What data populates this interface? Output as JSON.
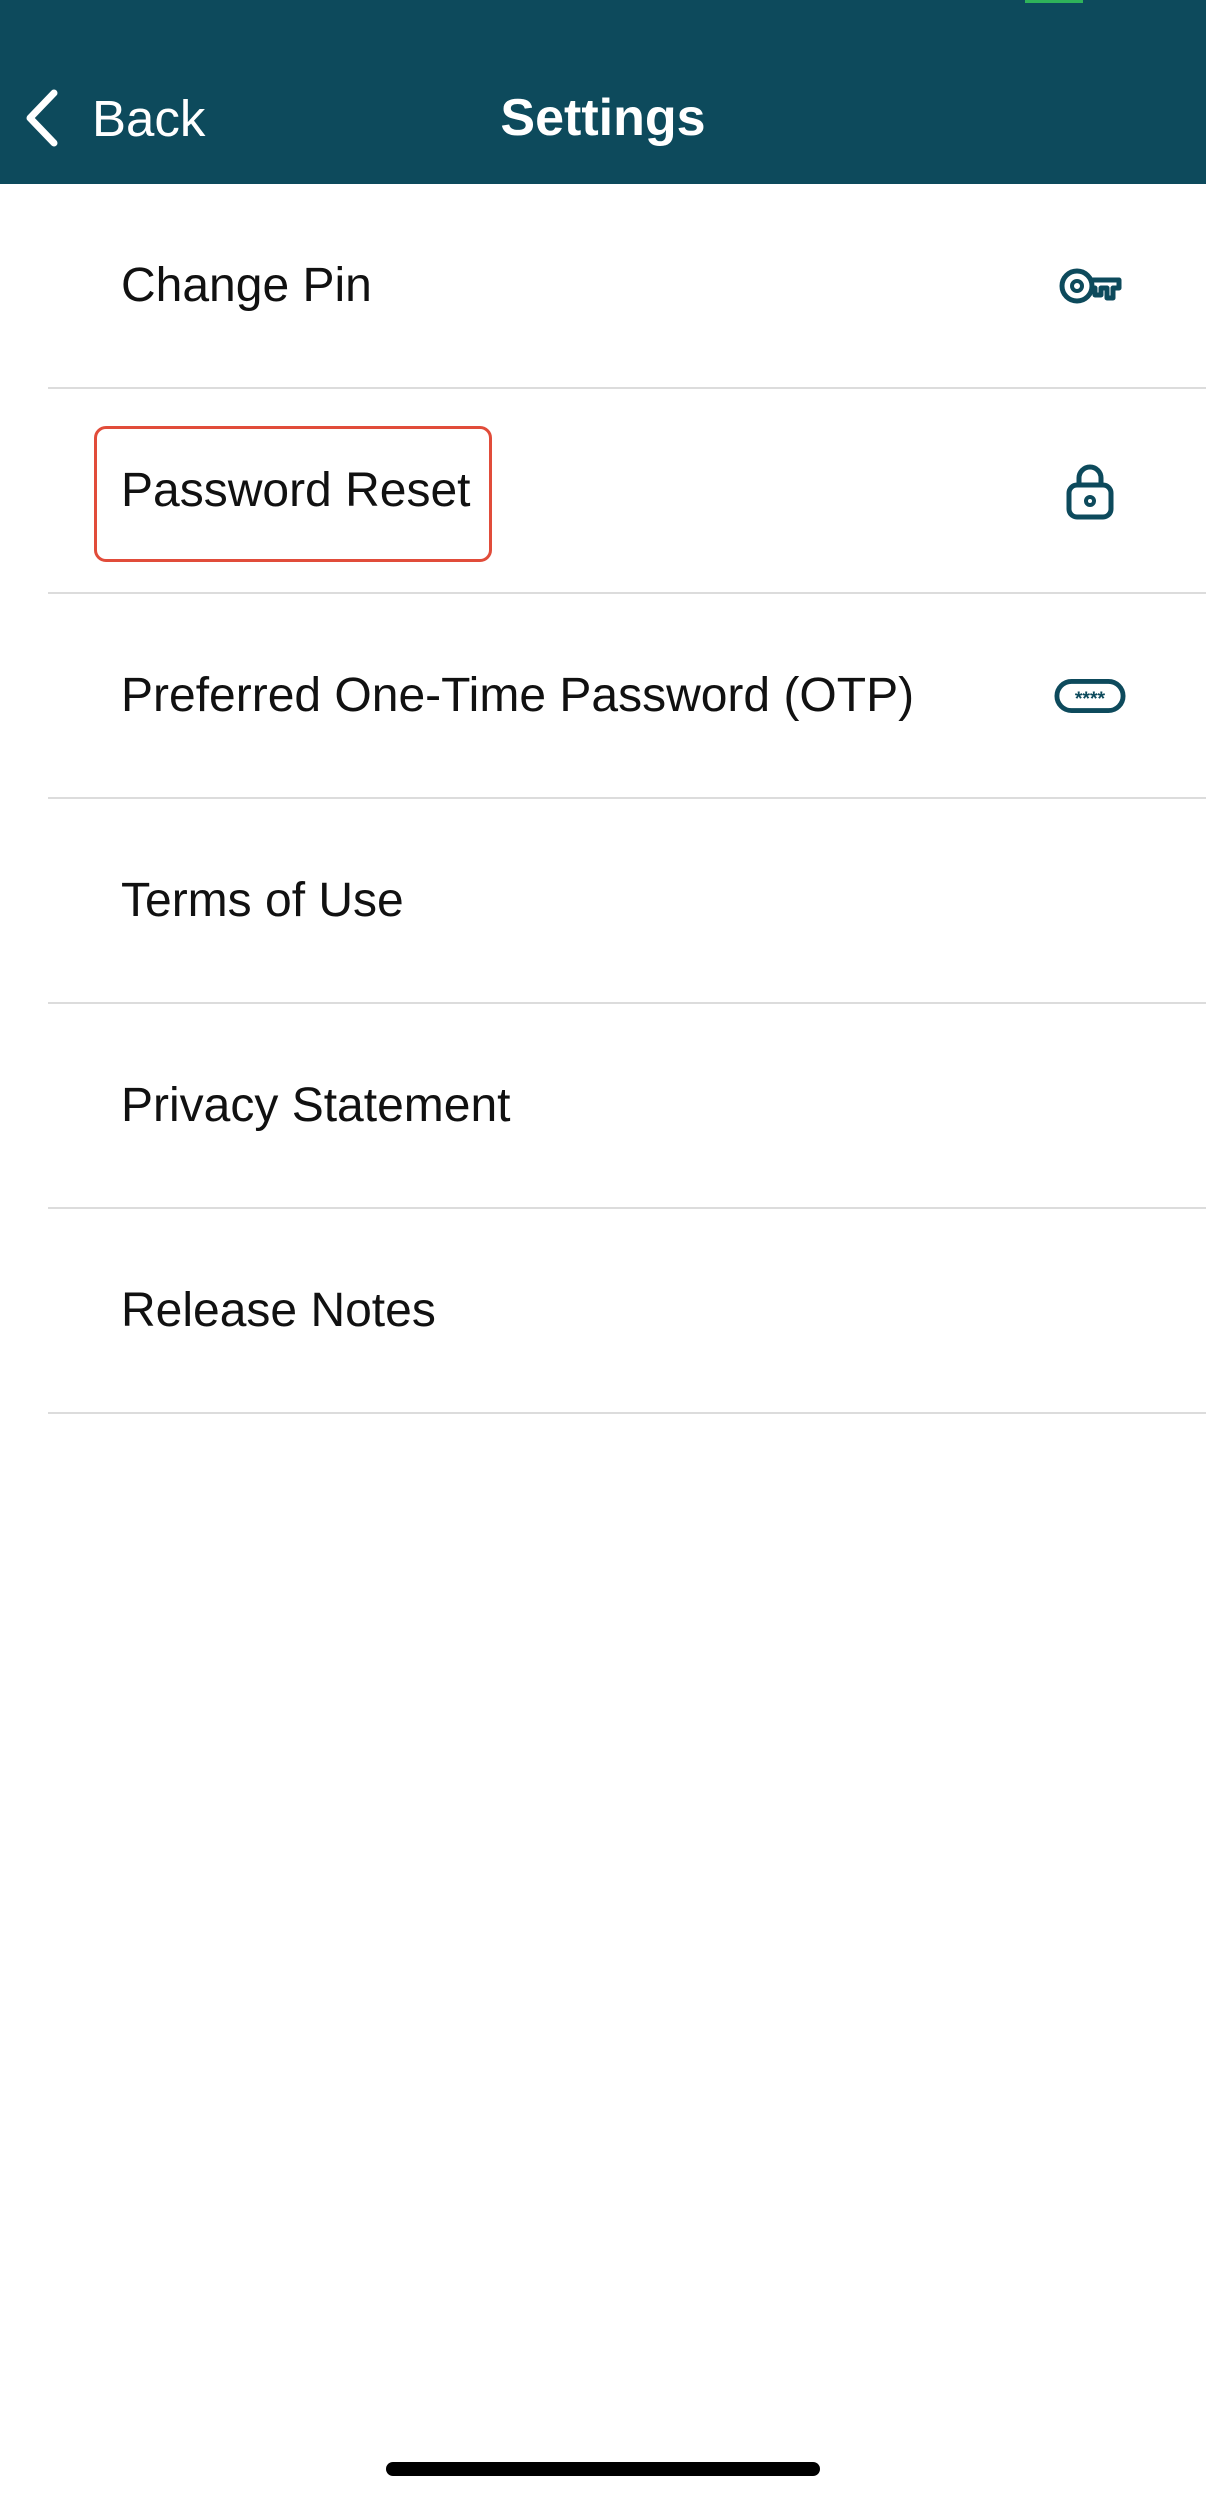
{
  "nav": {
    "back_label": "Back",
    "title": "Settings"
  },
  "settings": {
    "items": [
      {
        "label": "Change Pin",
        "icon": "key-icon"
      },
      {
        "label": "Password Reset",
        "icon": "lock-icon"
      },
      {
        "label": "Preferred One-Time Password (OTP)",
        "icon": "password-field-icon"
      },
      {
        "label": "Terms of Use"
      },
      {
        "label": "Privacy Statement"
      },
      {
        "label": "Release Notes"
      }
    ]
  },
  "otp_icon_text": "****",
  "colors": {
    "nav_background": "#0d4a5c",
    "icon_color": "#0d4a5c",
    "highlight": "#e14c3a",
    "divider": "#dcdcdc",
    "status_accent": "#2fb35a"
  }
}
